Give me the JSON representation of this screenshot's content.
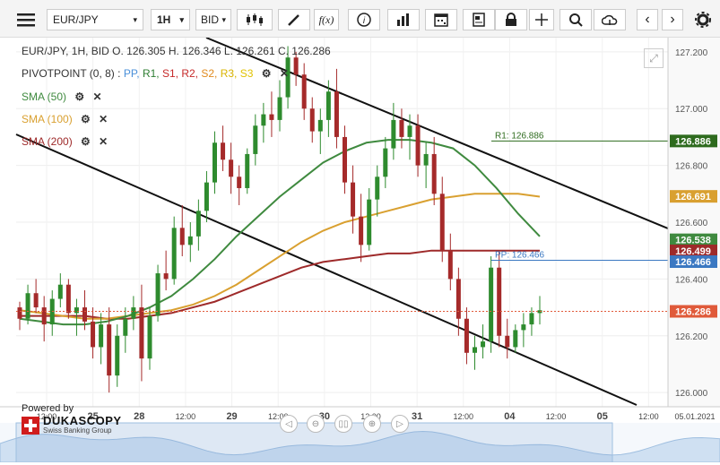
{
  "toolbar": {
    "instrument": "EUR/JPY",
    "timeframe": "1H",
    "side": "BID",
    "fx_label": "f(x)"
  },
  "legend": {
    "ohlc": "EUR/JPY, 1H, BID   O. 126.305 H. 126.346 L. 126.261 C. 126.286",
    "pivot_label": "PIVOTPOINT (0, 8)",
    "pivot_items": [
      {
        "label": "PP,",
        "color": "#4a90d9"
      },
      {
        "label": "R1,",
        "color": "#2e7d32"
      },
      {
        "label": "S1,",
        "color": "#c62828"
      },
      {
        "label": "R2,",
        "color": "#c62828"
      },
      {
        "label": "S2,",
        "color": "#e08a1e"
      },
      {
        "label": "R3,",
        "color": "#d9b400"
      },
      {
        "label": "S3",
        "color": "#e0c200"
      }
    ],
    "sma50": "SMA (50)",
    "sma100": "SMA (100)",
    "sma200": "SMA (200)"
  },
  "colors": {
    "sma50": "#3f8a3f",
    "sma100": "#d9a030",
    "sma200": "#9e2a2a",
    "candle_up": "#2e8b2e",
    "candle_down": "#a52a2a",
    "r1": "#2e6b1e",
    "pp": "#3b78c2",
    "last": "#e05a3a"
  },
  "branding": {
    "powered_by": "Powered by",
    "name": "DUKASCOPY",
    "tagline": "Swiss Banking Group"
  },
  "chart_data": {
    "type": "candlestick",
    "y_axis": {
      "min": 125.95,
      "max": 127.25,
      "ticks": [
        "127.200",
        "127.000",
        "126.800",
        "126.600",
        "126.400",
        "126.200",
        "126.000"
      ]
    },
    "x_ticks": [
      "12:00",
      "25",
      "28",
      "12:00",
      "29",
      "12:00",
      "30",
      "12:00",
      "31",
      "12:00",
      "04",
      "12:00",
      "05",
      "12:00",
      "05.01.2021"
    ],
    "price_labels": [
      {
        "label": "126.886",
        "value": 126.886,
        "color": "#2e6b1e"
      },
      {
        "label": "126.691",
        "value": 126.691,
        "color": "#d9a030"
      },
      {
        "label": "126.538",
        "value": 126.538,
        "color": "#3f8a3f"
      },
      {
        "label": "126.499",
        "value": 126.499,
        "color": "#9e2a2a"
      },
      {
        "label": "126.466",
        "value": 126.466,
        "color": "#3b78c2"
      },
      {
        "label": "126.286",
        "value": 126.286,
        "color": "#e05a3a"
      }
    ],
    "pivot_lines": [
      {
        "label": "R1: 126.886",
        "value": 126.886
      },
      {
        "label": "PP: 126.466",
        "value": 126.466
      }
    ],
    "last_price": 126.286,
    "candles": [
      [
        126.3,
        126.32,
        126.22,
        126.26
      ],
      [
        126.26,
        126.38,
        126.24,
        126.35
      ],
      [
        126.35,
        126.4,
        126.28,
        126.3
      ],
      [
        126.3,
        126.34,
        126.18,
        126.24
      ],
      [
        126.24,
        126.36,
        126.2,
        126.33
      ],
      [
        126.33,
        126.42,
        126.3,
        126.38
      ],
      [
        126.38,
        126.4,
        126.26,
        126.28
      ],
      [
        126.28,
        126.33,
        126.2,
        126.3
      ],
      [
        126.3,
        126.36,
        126.22,
        126.25
      ],
      [
        126.25,
        126.3,
        126.12,
        126.16
      ],
      [
        126.16,
        126.28,
        126.1,
        126.24
      ],
      [
        126.24,
        126.3,
        126.0,
        126.06
      ],
      [
        126.06,
        126.24,
        126.02,
        126.2
      ],
      [
        126.2,
        126.3,
        126.14,
        126.26
      ],
      [
        126.26,
        126.34,
        126.22,
        126.3
      ],
      [
        126.3,
        126.38,
        126.04,
        126.12
      ],
      [
        126.12,
        126.3,
        126.08,
        126.27
      ],
      [
        126.27,
        126.45,
        126.25,
        126.42
      ],
      [
        126.42,
        126.5,
        126.36,
        126.4
      ],
      [
        126.4,
        126.62,
        126.38,
        126.58
      ],
      [
        126.58,
        126.66,
        126.48,
        126.52
      ],
      [
        126.52,
        126.6,
        126.46,
        126.55
      ],
      [
        126.55,
        126.68,
        126.5,
        126.64
      ],
      [
        126.64,
        126.78,
        126.6,
        126.74
      ],
      [
        126.74,
        126.92,
        126.7,
        126.88
      ],
      [
        126.88,
        126.94,
        126.78,
        126.82
      ],
      [
        126.82,
        126.88,
        126.7,
        126.76
      ],
      [
        126.76,
        126.8,
        126.66,
        126.72
      ],
      [
        126.72,
        126.86,
        126.7,
        126.84
      ],
      [
        126.84,
        126.98,
        126.8,
        126.94
      ],
      [
        126.94,
        127.02,
        126.88,
        126.98
      ],
      [
        126.98,
        127.06,
        126.9,
        126.96
      ],
      [
        126.96,
        127.1,
        126.92,
        127.04
      ],
      [
        127.04,
        127.22,
        127.0,
        127.18
      ],
      [
        127.18,
        127.2,
        127.08,
        127.12
      ],
      [
        127.12,
        127.16,
        126.96,
        127.0
      ],
      [
        127.0,
        127.04,
        126.88,
        126.92
      ],
      [
        126.92,
        127.0,
        126.84,
        126.96
      ],
      [
        126.96,
        127.1,
        126.9,
        127.06
      ],
      [
        127.06,
        127.14,
        126.86,
        126.9
      ],
      [
        126.9,
        126.94,
        126.7,
        126.74
      ],
      [
        126.74,
        126.8,
        126.56,
        126.62
      ],
      [
        126.62,
        126.7,
        126.46,
        126.52
      ],
      [
        126.52,
        126.72,
        126.5,
        126.68
      ],
      [
        126.68,
        126.8,
        126.62,
        126.76
      ],
      [
        126.76,
        126.9,
        126.72,
        126.86
      ],
      [
        126.86,
        127.02,
        126.82,
        126.96
      ],
      [
        126.96,
        127.0,
        126.86,
        126.9
      ],
      [
        126.9,
        126.98,
        126.82,
        126.94
      ],
      [
        126.94,
        126.98,
        126.76,
        126.8
      ],
      [
        126.8,
        126.88,
        126.72,
        126.84
      ],
      [
        126.84,
        126.9,
        126.66,
        126.7
      ],
      [
        126.7,
        126.76,
        126.46,
        126.5
      ],
      [
        126.5,
        126.56,
        126.36,
        126.4
      ],
      [
        126.4,
        126.44,
        126.2,
        126.26
      ],
      [
        126.26,
        126.3,
        126.1,
        126.14
      ],
      [
        126.14,
        126.2,
        126.08,
        126.16
      ],
      [
        126.16,
        126.24,
        126.12,
        126.18
      ],
      [
        126.18,
        126.48,
        126.14,
        126.44
      ],
      [
        126.44,
        126.5,
        126.16,
        126.2
      ],
      [
        126.2,
        126.26,
        126.12,
        126.16
      ],
      [
        126.16,
        126.24,
        126.14,
        126.22
      ],
      [
        126.22,
        126.28,
        126.16,
        126.24
      ],
      [
        126.24,
        126.3,
        126.2,
        126.28
      ],
      [
        126.28,
        126.34,
        126.24,
        126.29
      ]
    ],
    "sma50": [
      126.26,
      126.25,
      126.24,
      126.24,
      126.25,
      126.27,
      126.3,
      126.34,
      126.4,
      126.47,
      126.55,
      126.62,
      126.69,
      126.75,
      126.81,
      126.85,
      126.88,
      126.89,
      126.89,
      126.88,
      126.86,
      126.8,
      126.72,
      126.63,
      126.55
    ],
    "sma100": [
      126.29,
      126.28,
      126.27,
      126.26,
      126.26,
      126.27,
      126.28,
      126.29,
      126.31,
      126.34,
      126.38,
      126.43,
      126.48,
      126.53,
      126.57,
      126.6,
      126.62,
      126.64,
      126.66,
      126.68,
      126.69,
      126.7,
      126.7,
      126.7,
      126.69
    ],
    "sma200": [
      126.27,
      126.27,
      126.27,
      126.27,
      126.26,
      126.26,
      126.27,
      126.28,
      126.3,
      126.32,
      126.35,
      126.38,
      126.41,
      126.44,
      126.46,
      126.47,
      126.48,
      126.49,
      126.49,
      126.5,
      126.5,
      126.5,
      126.5,
      126.5,
      126.5
    ]
  }
}
